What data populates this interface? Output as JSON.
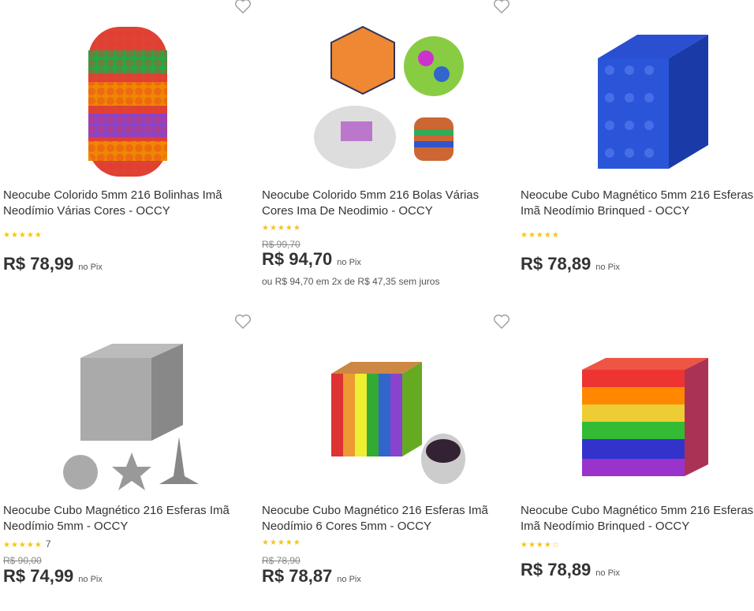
{
  "products": [
    {
      "title": "Neocube Colorido 5mm 216 Bolinhas Imã Neodímio Várias Cores - OCCY",
      "stars": "★★★★★",
      "review_count": "",
      "old_price": "",
      "price": "R$ 78,99",
      "price_suffix": "no Pix",
      "installment": ""
    },
    {
      "title": "Neocube Colorido 5mm 216 Bolas Várias Cores Ima De Neodimio - OCCY",
      "stars": "★★★★★",
      "review_count": "",
      "old_price": "R$ 99,70",
      "price": "R$ 94,70",
      "price_suffix": "no Pix",
      "installment": "ou R$ 94,70 em 2x de R$ 47,35 sem juros"
    },
    {
      "title": "Neocube Cubo Magnético 5mm 216 Esferas Imã Neodímio Brinqued - OCCY",
      "stars": "★★★★★",
      "review_count": "",
      "old_price": "",
      "price": "R$ 78,89",
      "price_suffix": "no Pix",
      "installment": ""
    },
    {
      "title": "Neocube Cubo Magnético 216 Esferas Imã Neodímio 5mm - OCCY",
      "stars": "★★★★★",
      "review_count": "7",
      "old_price": "R$ 90,00",
      "price": "R$ 74,99",
      "price_suffix": "no Pix",
      "installment": ""
    },
    {
      "title": "Neocube Cubo Magnético 216 Esferas Imã Neodímio 6 Cores 5mm - OCCY",
      "stars": "★★★★★",
      "review_count": "",
      "old_price": "R$ 78,90",
      "price": "R$ 78,87",
      "price_suffix": "no Pix",
      "installment": ""
    },
    {
      "title": "Neocube Cubo Magnético 5mm 216 Esferas Imã Neodímio Brinqued - OCCY",
      "stars": "★★★★☆",
      "review_count": "",
      "old_price": "",
      "price": "R$ 78,89",
      "price_suffix": "no Pix",
      "installment": ""
    }
  ],
  "icons": {
    "favorite": "heart-outline-icon",
    "rating": "star-icon"
  },
  "colors": {
    "star": "#f5c518",
    "text": "#333333",
    "muted": "#888888"
  }
}
